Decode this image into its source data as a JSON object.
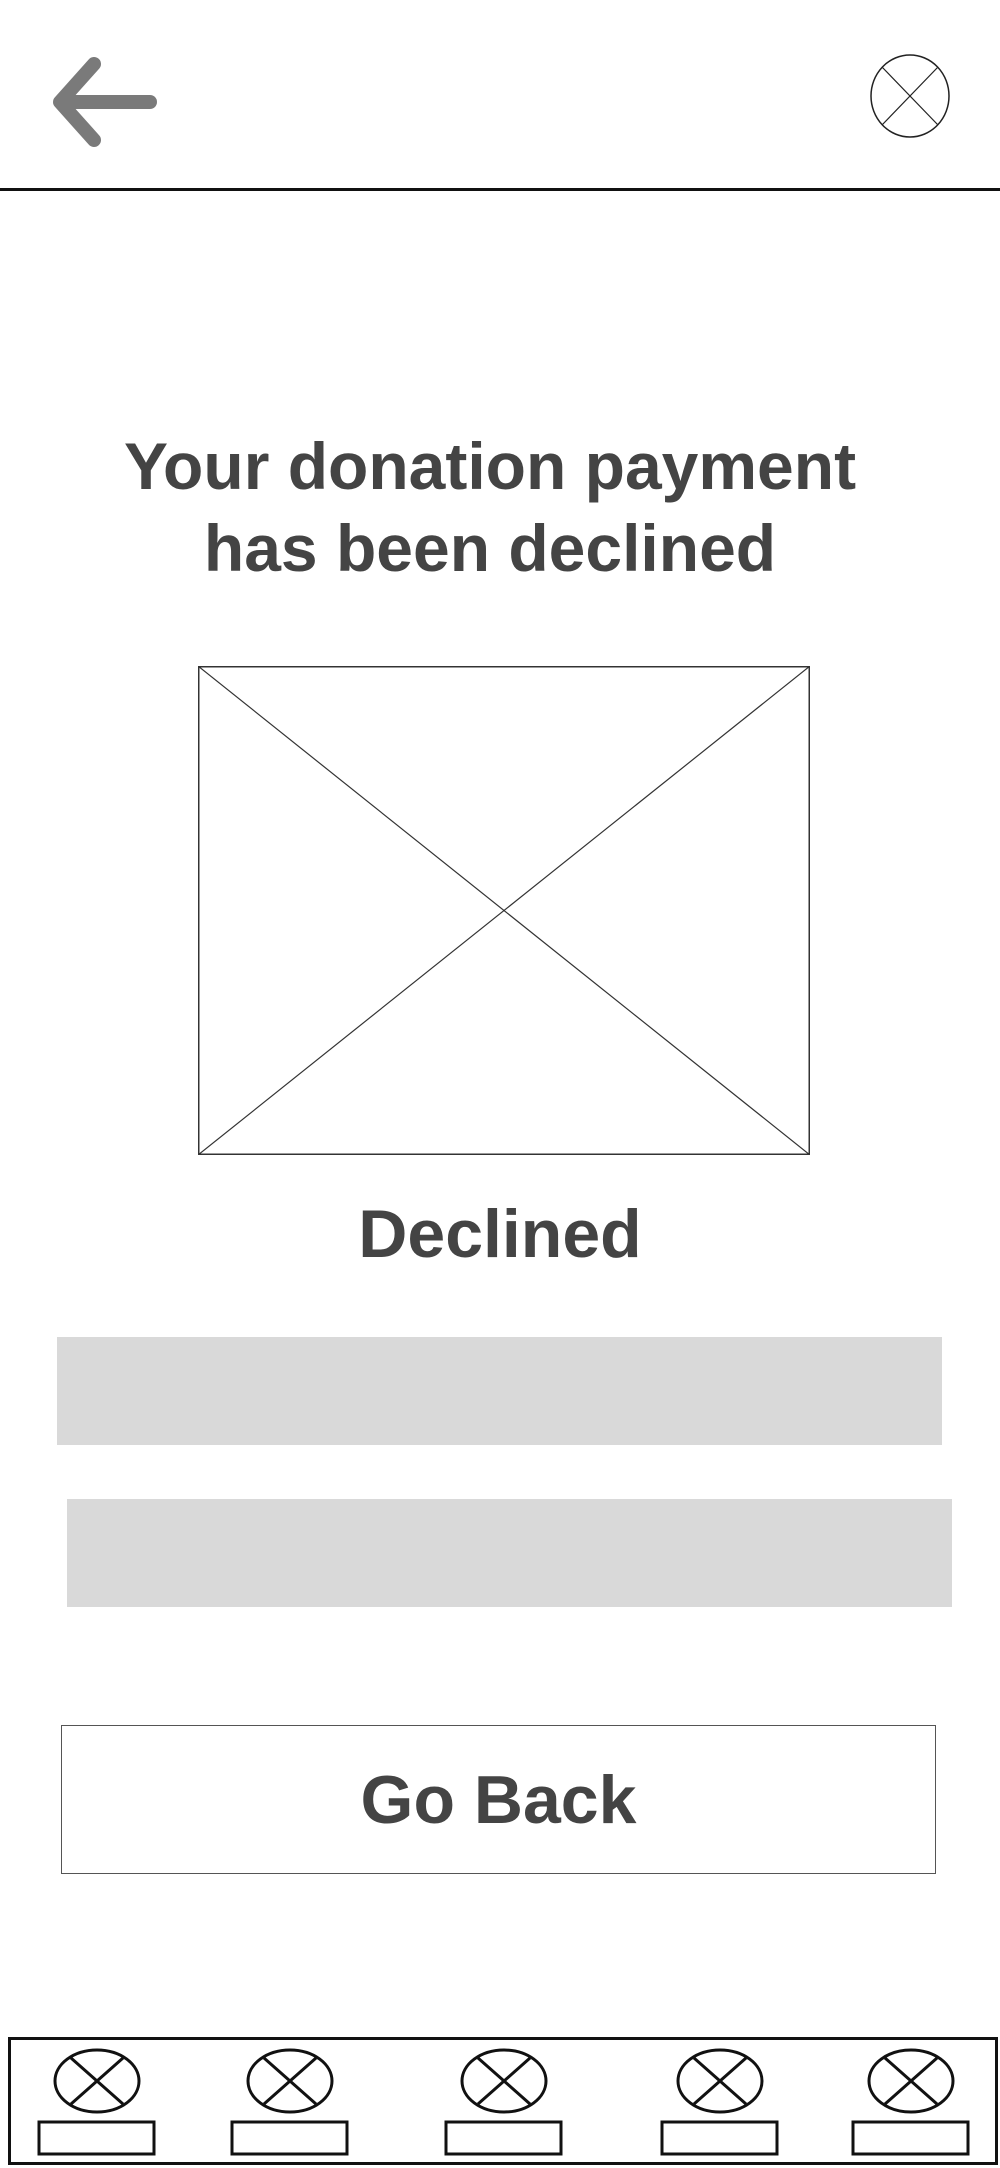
{
  "header": {
    "back_icon": "arrow-left-icon",
    "close_icon": "close-circle-icon"
  },
  "main": {
    "title_line1": "Your donation payment",
    "title_line2": "has been declined",
    "image_icon": "image-placeholder-icon",
    "status_label": "Declined",
    "go_back_label": "Go Back"
  },
  "bottom_nav": {
    "items": [
      {
        "icon": "nav-placeholder-icon"
      },
      {
        "icon": "nav-placeholder-icon"
      },
      {
        "icon": "nav-placeholder-icon"
      },
      {
        "icon": "nav-placeholder-icon"
      },
      {
        "icon": "nav-placeholder-icon"
      }
    ]
  },
  "colors": {
    "text": "#444444",
    "bar": "#d9d9d9",
    "divider": "#111111",
    "arrow": "#7a7a7a"
  }
}
